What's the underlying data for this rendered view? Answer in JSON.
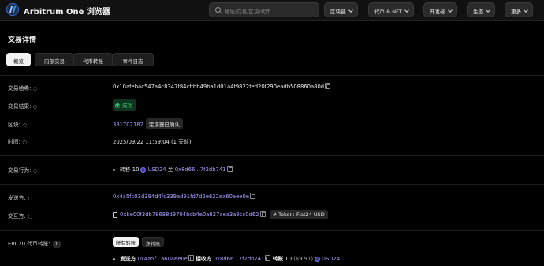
{
  "header": {
    "app_title": "Arbitrum One 浏览器",
    "search_placeholder": "地址/交易/区块/代币",
    "nav": [
      "区块链",
      "代币 & NFT",
      "开发者",
      "生态",
      "更多"
    ]
  },
  "page": {
    "title": "交易详情",
    "tabs": [
      "概览",
      "内部交易",
      "代币转账",
      "事件日志"
    ],
    "active_tab": "概览"
  },
  "overview": {
    "hash_label": "交易哈希:",
    "hash_value": "0x10afebac547a4c8347f84cffbb49ba1d01a4f9822fed20f290eadb508860a80d",
    "result_label": "交易结果:",
    "result_value": "成功",
    "block_label": "区块:",
    "block_value": "381702182",
    "block_badge": "定序器已确认",
    "time_label": "时间:",
    "time_value": "2025/09/22 11:59:04 (1 天前)",
    "action_label": "交易行为:",
    "action_transfer": "转移",
    "action_amount": "10",
    "action_token": "USD24",
    "action_to": "至",
    "action_address": "0x8d66...7f2db741",
    "from_label": "发送方:",
    "from_value": "0x4a5fc03d394d4fc339ad91fd7d2e622ea60aee0e",
    "interact_label": "交互方:",
    "interact_value": "0xbe00f3db78688d9704bcb4e0a827aea3a9cc0d62",
    "interact_tag": "# Token: Fiat24 USD",
    "erc20_label": "ERC20 代币转账:",
    "erc20_count": "1",
    "erc20_filters": [
      "所有转账",
      "净转账"
    ],
    "transfer_from_label": "发送方",
    "transfer_from": "0x4a5f...a60aee0e",
    "transfer_to_label": "接收方",
    "transfer_to": "0x8d66...7f2db741",
    "transfer_amount_label": "转账",
    "transfer_amount": "10",
    "transfer_usd": "($9.91)",
    "transfer_token": "USD24"
  },
  "colors": {
    "background": "#000000",
    "link": "#a7a0ff",
    "success": "#46d17a"
  }
}
